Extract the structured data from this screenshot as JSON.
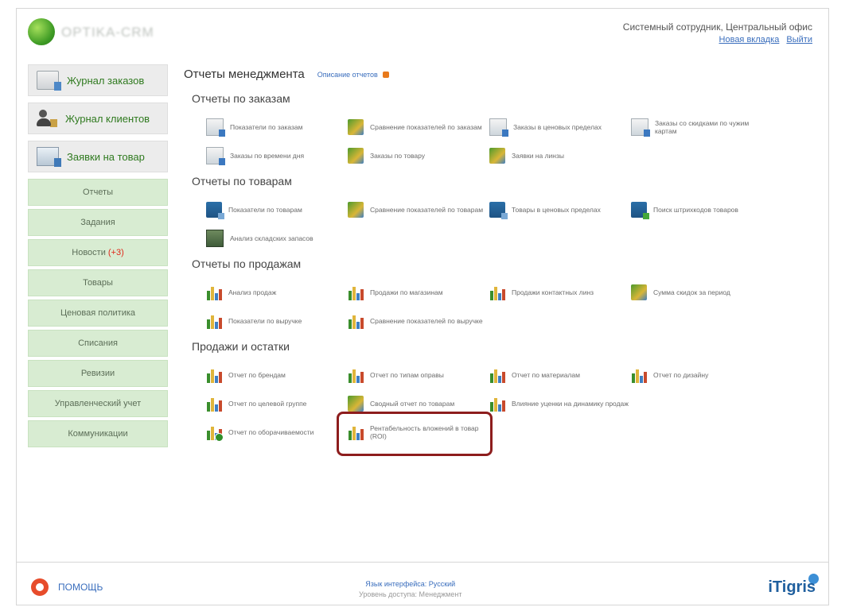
{
  "header": {
    "logo_text": "OPTIKA-CRM",
    "user_line": "Системный сотрудник, Центральный офис",
    "links": [
      "Новая вкладка",
      "Выйти"
    ]
  },
  "sidebar": {
    "big_items": [
      {
        "label": "Журнал заказов",
        "icon": "journal-icon"
      },
      {
        "label": "Журнал клиентов",
        "icon": "clients-icon"
      },
      {
        "label": "Заявки на товар",
        "icon": "goods-request-icon"
      }
    ],
    "items": [
      {
        "label": "Отчеты"
      },
      {
        "label": "Задания"
      },
      {
        "label": "Новости",
        "badge": "(+3)"
      },
      {
        "label": "Товары"
      },
      {
        "label": "Ценовая политика"
      },
      {
        "label": "Списания"
      },
      {
        "label": "Ревизии"
      },
      {
        "label": "Управленческий учет"
      },
      {
        "label": "Коммуникации"
      }
    ]
  },
  "main": {
    "title": "Отчеты менеджмента",
    "description_link": "Описание отчетов",
    "sections": [
      {
        "title": "Отчеты по заказам",
        "reports": [
          {
            "label": "Показатели по заказам",
            "icon": "doc"
          },
          {
            "label": "Сравнение показателей по заказам",
            "icon": "chart"
          },
          {
            "label": "Заказы в ценовых пределах",
            "icon": "doc"
          },
          {
            "label": "Заказы со скидками по чужим картам",
            "icon": "doc"
          },
          {
            "label": "Заказы по времени дня",
            "icon": "doc"
          },
          {
            "label": "Заказы по товару",
            "icon": "chart"
          },
          {
            "label": "Заявки на линзы",
            "icon": "chart"
          }
        ]
      },
      {
        "title": "Отчеты по товарам",
        "reports": [
          {
            "label": "Показатели по товарам",
            "icon": "box"
          },
          {
            "label": "Сравнение показателей по товарам",
            "icon": "chart"
          },
          {
            "label": "Товары в ценовых пределах",
            "icon": "box"
          },
          {
            "label": "Поиск штрихкодов товаров",
            "icon": "box-green"
          },
          {
            "label": "Анализ складских запасов",
            "icon": "photo"
          }
        ]
      },
      {
        "title": "Отчеты по продажам",
        "reports": [
          {
            "label": "Анализ продаж",
            "icon": "bar"
          },
          {
            "label": "Продажи по магазинам",
            "icon": "bar"
          },
          {
            "label": "Продажи контактных линз",
            "icon": "bar"
          },
          {
            "label": "Сумма скидок за период",
            "icon": "chart"
          },
          {
            "label": "Показатели по выручке",
            "icon": "bar"
          },
          {
            "label": "Сравнение показателей по выручке",
            "icon": "bar"
          }
        ]
      },
      {
        "title": "Продажи и остатки",
        "reports": [
          {
            "label": "Отчет по брендам",
            "icon": "bar"
          },
          {
            "label": "Отчет по типам оправы",
            "icon": "bar"
          },
          {
            "label": "Отчет по материалам",
            "icon": "bar"
          },
          {
            "label": "Отчет по дизайну",
            "icon": "bar"
          },
          {
            "label": "Отчет по целевой группе",
            "icon": "bar"
          },
          {
            "label": "Сводный отчет по товарам",
            "icon": "chart"
          },
          {
            "label": "Влияние уценки на динамику продаж",
            "icon": "bar"
          },
          {
            "label": "",
            "icon": "empty"
          },
          {
            "label": "Отчет по оборачиваемости",
            "icon": "bar-round"
          },
          {
            "label": "Рентабельность вложений в товар (ROI)",
            "icon": "bar",
            "highlighted": true
          }
        ]
      }
    ]
  },
  "footer": {
    "help_label": "ПОМОЩЬ",
    "language_line": "Язык интерфейса: Русский",
    "access_line": "Уровень доступа: Менеджмент",
    "brand": "iTigris"
  }
}
